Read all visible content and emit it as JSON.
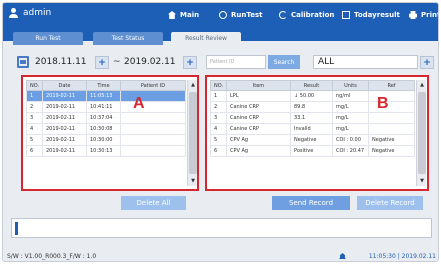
{
  "header": {
    "user": "admin",
    "nav": [
      {
        "label": "Main",
        "icon": "home-icon"
      },
      {
        "label": "RunTest",
        "icon": "circle-icon"
      },
      {
        "label": "Calibration",
        "icon": "calibration-icon"
      },
      {
        "label": "Todayresult",
        "icon": "list-icon"
      },
      {
        "label": "Print",
        "icon": "printer-icon"
      }
    ]
  },
  "tabs": [
    {
      "label": "Run Test",
      "active": false
    },
    {
      "label": "Test Status",
      "active": false
    },
    {
      "label": "Result Review",
      "active": true
    }
  ],
  "filters": {
    "date_from": "2018.11.11",
    "separator": "~",
    "date_to": "2019.02.11",
    "search_placeholder": "Patient ID",
    "search_button": "Search",
    "select_value": "ALL"
  },
  "panel_a": {
    "letter": "A",
    "columns": [
      "NO.",
      "Date",
      "Time",
      "Patient ID"
    ],
    "rows": [
      {
        "no": "1",
        "date": "2019-02-11",
        "time": "11:05:13",
        "pid": ""
      },
      {
        "no": "2",
        "date": "2019-02-11",
        "time": "10:41:11",
        "pid": ""
      },
      {
        "no": "3",
        "date": "2019-02-11",
        "time": "10:37:04",
        "pid": ""
      },
      {
        "no": "4",
        "date": "2019-02-11",
        "time": "10:30:08",
        "pid": ""
      },
      {
        "no": "5",
        "date": "2019-02-11",
        "time": "10:30:00",
        "pid": ""
      },
      {
        "no": "6",
        "date": "2019-02-11",
        "time": "10:30:13",
        "pid": ""
      }
    ]
  },
  "panel_b": {
    "letter": "B",
    "columns": [
      "NO.",
      "Item",
      "Result",
      "Units",
      "Ref"
    ],
    "rows": [
      {
        "no": "1",
        "item": "LPL",
        "result": "↓ 50.00",
        "units": "ng/ml",
        "ref": ""
      },
      {
        "no": "2",
        "item": "Canine CRP",
        "result": "89.8",
        "units": "mg/L",
        "ref": ""
      },
      {
        "no": "3",
        "item": "Canine CRP",
        "result": "33.1",
        "units": "mg/L",
        "ref": ""
      },
      {
        "no": "4",
        "item": "Canine CRP",
        "result": "Invalid",
        "units": "mg/L",
        "ref": ""
      },
      {
        "no": "5",
        "item": "CPV Ag",
        "result": "Negative",
        "units": "COI : 0.00",
        "ref": "Negative"
      },
      {
        "no": "6",
        "item": "CPV Ag",
        "result": "Positive",
        "units": "COI : 20.47",
        "ref": "Negative"
      }
    ]
  },
  "buttons": {
    "delete_all": "Delete All",
    "send_record": "Send Record",
    "delete_record": "Delete Record"
  },
  "footer": {
    "firmware": "S/W : V1.00_R000.3_F/W : 1.0",
    "datetime": "11:05:30 | 2019.02.11"
  },
  "colors": {
    "header_blue": "#1d5fb7",
    "highlight_red": "#d8262e",
    "selected_row": "#6b9ee2"
  }
}
